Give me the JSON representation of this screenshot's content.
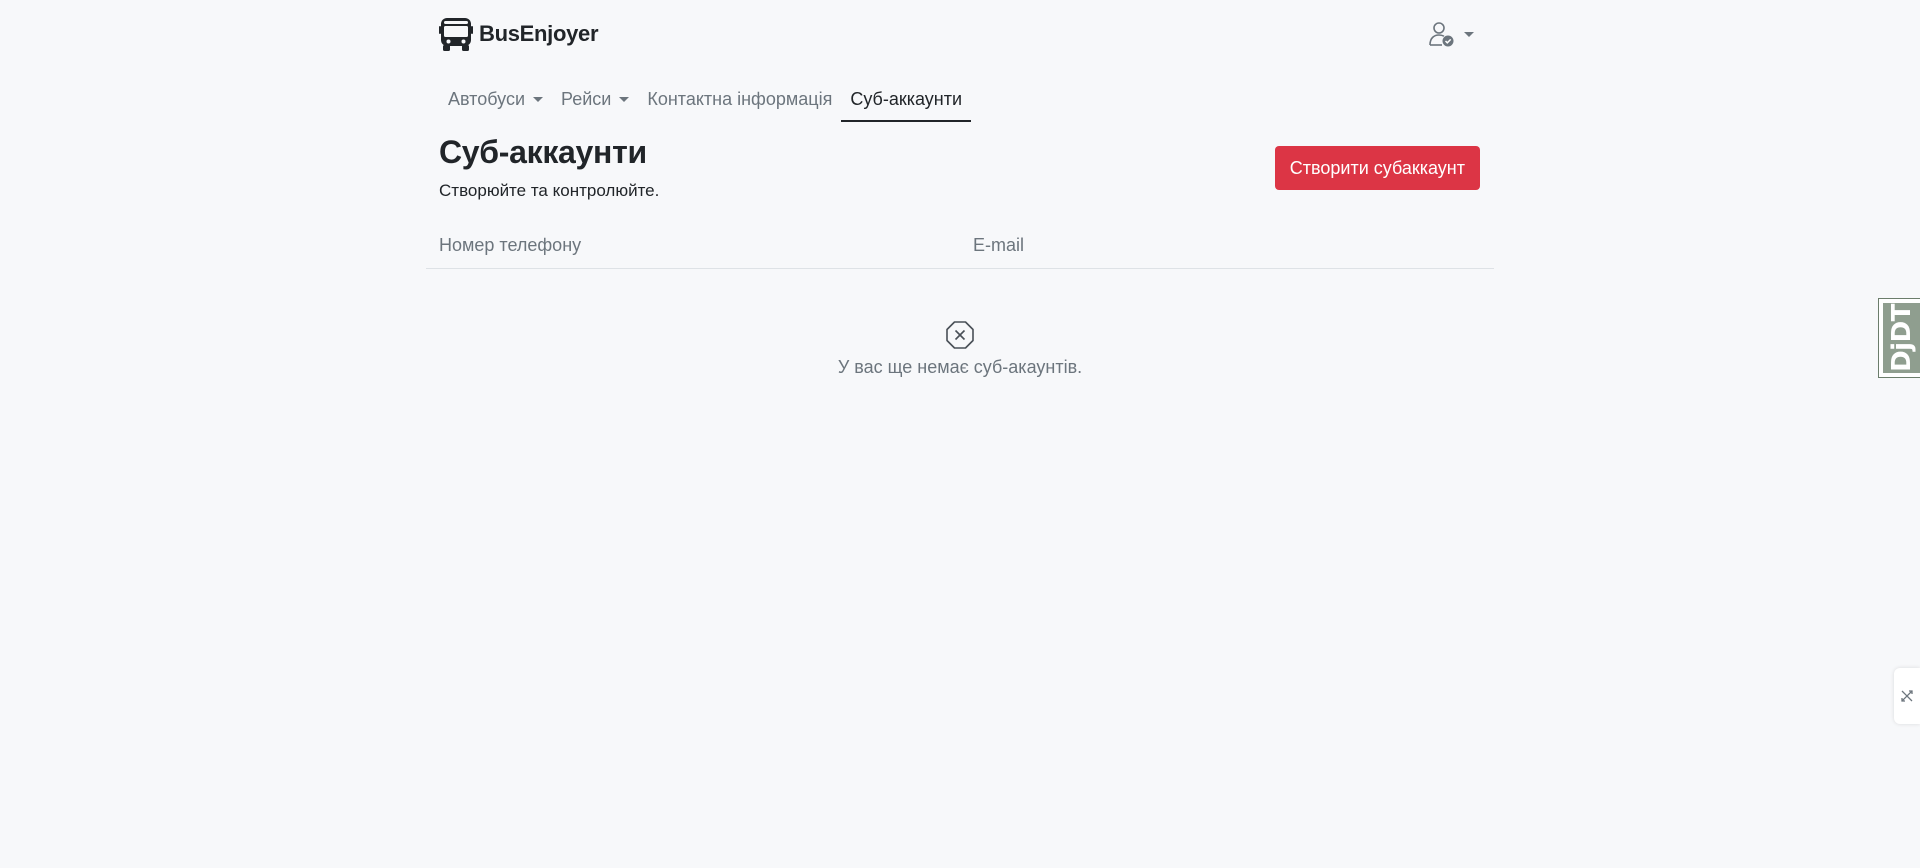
{
  "header": {
    "brand_name": "BusEnjoyer"
  },
  "nav": {
    "items": [
      {
        "label": "Автобуси",
        "dropdown": true,
        "active": false
      },
      {
        "label": "Рейси",
        "dropdown": true,
        "active": false
      },
      {
        "label": "Контактна інформація",
        "dropdown": false,
        "active": false
      },
      {
        "label": "Суб-аккаунти",
        "dropdown": false,
        "active": true
      }
    ]
  },
  "page": {
    "title": "Суб-аккаунти",
    "subtitle": "Створюйте та контролюйте.",
    "create_button_label": "Створити субаккаунт"
  },
  "table": {
    "columns": [
      "Номер телефону",
      "E-mail"
    ],
    "empty_message": "У вас ще немає суб-акаунтів."
  },
  "debug_toolbar": {
    "label": "DjDT"
  },
  "icons": {
    "brand": "bus-icon",
    "user": "user-check-icon",
    "empty": "x-octagon-icon",
    "side_widget": "cross-arrows-icon"
  },
  "colors": {
    "background": "#f7f8fa",
    "primary_button": "#dc3545",
    "muted_text": "#6c757d",
    "text": "#212529",
    "debug_toolbar": "#8f9e8f"
  }
}
